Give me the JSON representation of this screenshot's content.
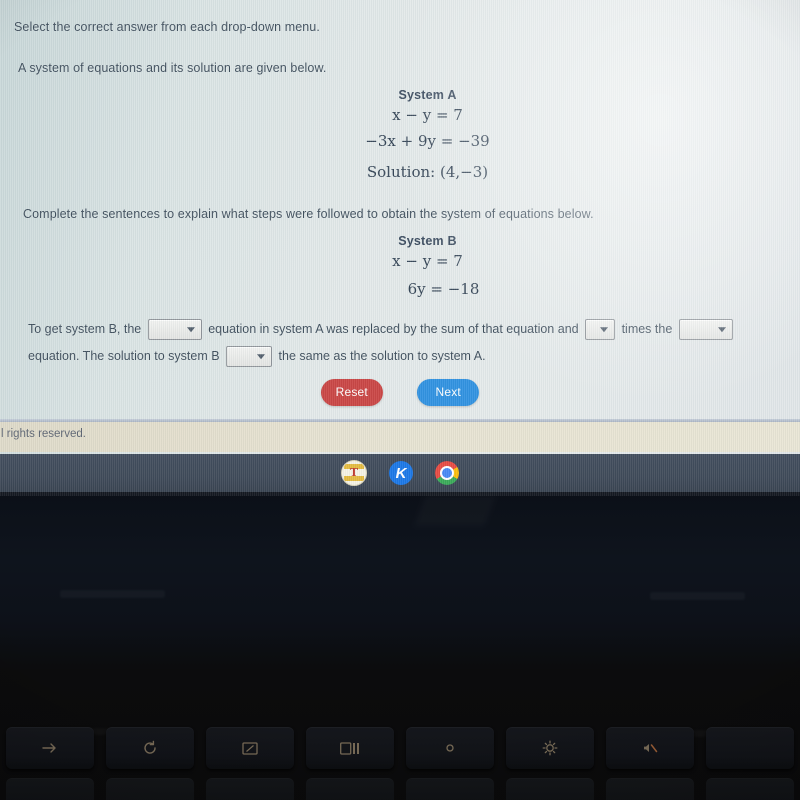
{
  "screen": {
    "instructions": {
      "line1": "Select the correct answer from each drop-down menu.",
      "line2": "A system of equations and its solution are given below.",
      "line3": "Complete the sentences to explain what steps were followed to obtain the system of equations below."
    },
    "system_a": {
      "title": "System A",
      "equation1": "x − y = 7",
      "equation1_lhs": "x",
      "equation1_mid": "−",
      "equation1_var": "y",
      "equation1_rhs": "= 7",
      "equation2": "−3x + 9y = −39",
      "solution_label": "Solution:",
      "solution_value": "(4,−3)"
    },
    "system_b": {
      "title": "System B",
      "equation1": "x − y = 7",
      "equation2": "6y = −18"
    },
    "sentence": {
      "part1": "To get system B, the",
      "part2": "equation in system A was replaced by the sum of that equation and",
      "part3": "times the",
      "part4": "equation. The solution to system B",
      "part5": "the same as the solution to system A.",
      "dropdown1_value": "",
      "dropdown2_value": "",
      "dropdown3_value": "",
      "dropdown4_value": "",
      "dropdown_icon": "chevron-down-icon"
    },
    "buttons": {
      "reset_label": "Reset",
      "next_label": "Next",
      "reset_color": "#c9403f",
      "next_color": "#2b8fe0"
    },
    "footer": {
      "text": "l rights reserved."
    },
    "shelf": {
      "icons": [
        {
          "name": "plato-courseware-icon",
          "label": "T"
        },
        {
          "name": "kami-icon",
          "label": "K"
        },
        {
          "name": "chrome-icon",
          "label": ""
        }
      ]
    }
  },
  "keyboard": {
    "function_keys": [
      {
        "name": "forward-key",
        "icon": "arrow-right-icon"
      },
      {
        "name": "reload-key",
        "icon": "reload-icon"
      },
      {
        "name": "fullscreen-key",
        "icon": "fullscreen-icon"
      },
      {
        "name": "overview-key",
        "icon": "window-overview-icon"
      },
      {
        "name": "brightness-down-key",
        "icon": "brightness-low-icon"
      },
      {
        "name": "brightness-up-key",
        "icon": "brightness-high-icon"
      },
      {
        "name": "mute-key",
        "icon": "volume-mute-icon"
      },
      {
        "name": "volume-down-key",
        "icon": "volume-down-icon"
      }
    ]
  }
}
